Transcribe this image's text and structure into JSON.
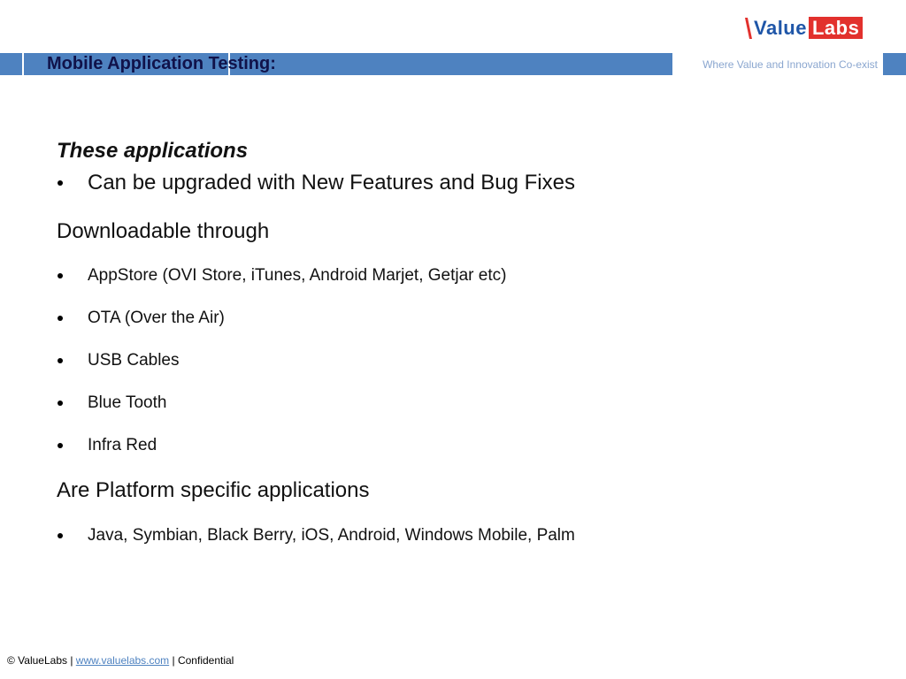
{
  "logo": {
    "value_text": "Value",
    "labs_text": "Labs",
    "colors": {
      "value": "#1f56a8",
      "labs_bg": "#e2312d",
      "mark": "#e2312d"
    }
  },
  "header": {
    "title": "Mobile Application Testing:",
    "tagline": "Where Value and Innovation Co-exist",
    "band_color": "#4e82c0"
  },
  "body": {
    "intro_heading": "These applications",
    "intro_bullets": [
      "Can be upgraded with New Features and Bug Fixes"
    ],
    "download_heading": "Downloadable through",
    "download_bullets": [
      "AppStore (OVI Store, iTunes, Android Marjet, Getjar etc)",
      "OTA (Over the Air)",
      "USB Cables",
      "Blue Tooth",
      "Infra Red"
    ],
    "platform_heading": "Are Platform specific applications",
    "platform_bullets": [
      "Java, Symbian, Black Berry, iOS, Android, Windows Mobile, Palm"
    ]
  },
  "footer": {
    "copyright": "© ValueLabs |",
    "link": "www.valuelabs.com",
    "suffix": "| Confidential"
  }
}
